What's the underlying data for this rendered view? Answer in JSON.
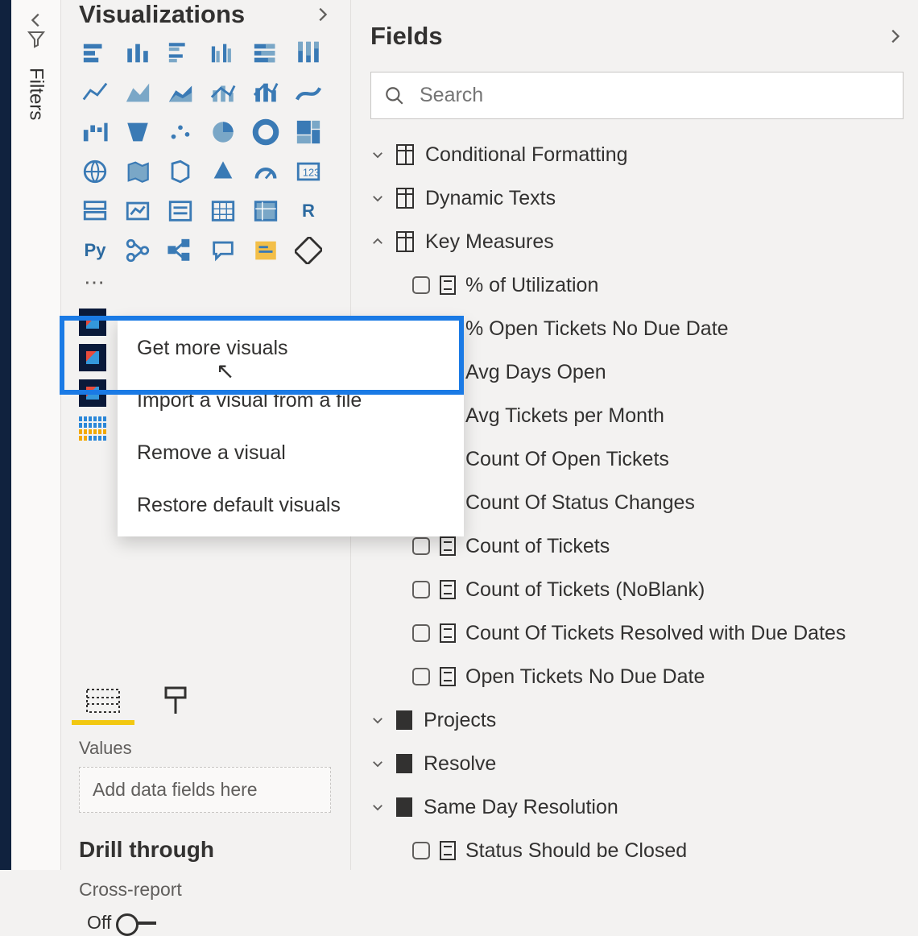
{
  "filters_tab": {
    "label": "Filters"
  },
  "viz_pane": {
    "title": "Visualizations",
    "context_menu": {
      "items": [
        "Get more visuals",
        "Import a visual from a file",
        "Remove a visual",
        "Restore default visuals"
      ]
    },
    "values_label": "Values",
    "add_fields_placeholder": "Add data fields here",
    "drill_through_label": "Drill through",
    "cross_report_label": "Cross-report",
    "toggle_off_label": "Off"
  },
  "fields_pane": {
    "title": "Fields",
    "search_placeholder": "Search",
    "tables": [
      {
        "name": "Conditional Formatting",
        "expanded": false,
        "type": "table"
      },
      {
        "name": "Dynamic Texts",
        "expanded": false,
        "type": "table"
      },
      {
        "name": "Key Measures",
        "expanded": true,
        "type": "table",
        "fields": [
          "% of Utilization",
          "% Open Tickets No Due Date",
          "Avg Days Open",
          "Avg Tickets per Month",
          "Count Of Open Tickets",
          "Count Of Status Changes",
          "Count of Tickets",
          "Count of Tickets (NoBlank)",
          "Count Of Tickets Resolved with Due Dates",
          "Open Tickets No Due Date"
        ]
      },
      {
        "name": "Projects",
        "expanded": false,
        "type": "folder"
      },
      {
        "name": "Resolve",
        "expanded": false,
        "type": "folder"
      },
      {
        "name": "Same Day Resolution",
        "expanded": false,
        "type": "folder",
        "fields": [
          "Status Should be Closed"
        ]
      }
    ]
  }
}
